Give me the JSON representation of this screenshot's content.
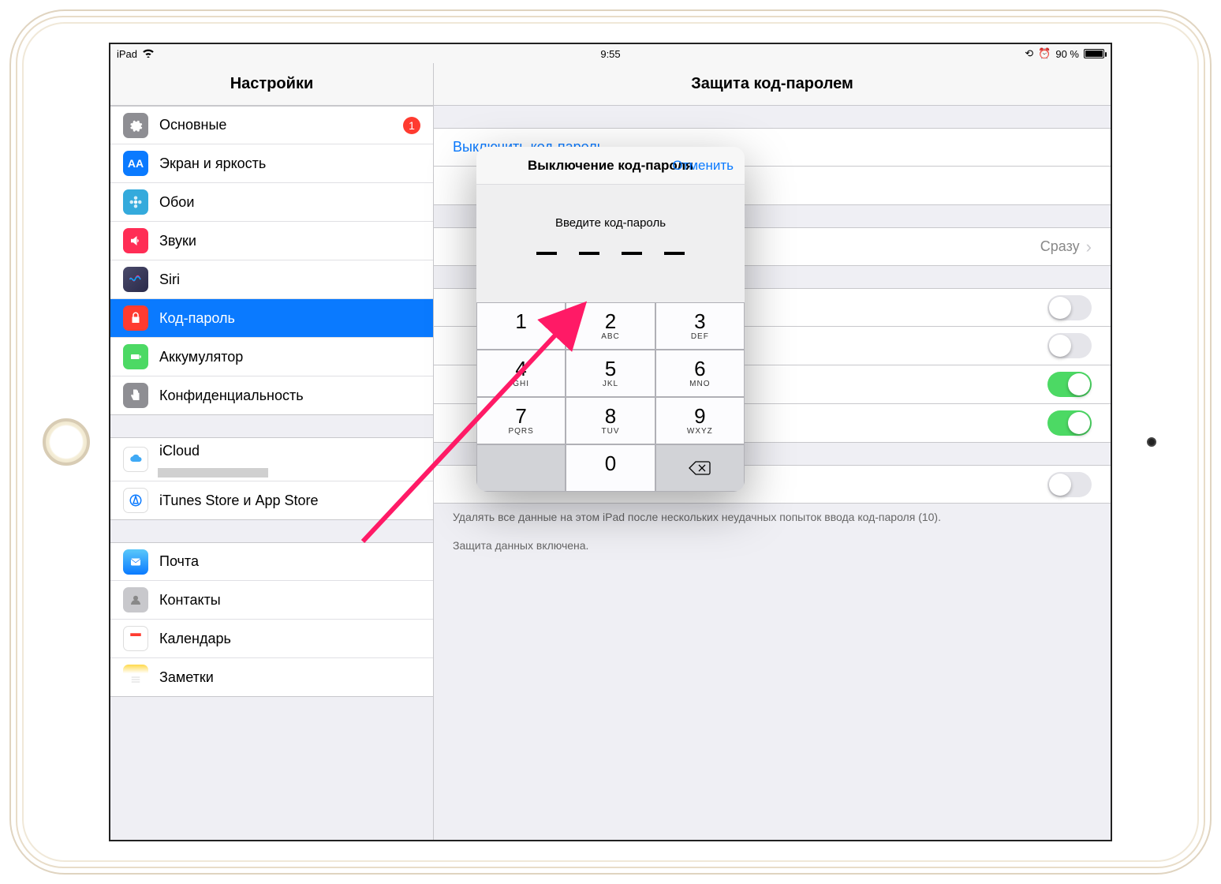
{
  "statusbar": {
    "device": "iPad",
    "time": "9:55",
    "battery_pct": "90 %"
  },
  "sidebar": {
    "title": "Настройки",
    "items": {
      "general": "Основные",
      "general_badge": "1",
      "display": "Экран и яркость",
      "wallpaper": "Обои",
      "sounds": "Звуки",
      "siri": "Siri",
      "passcode": "Код-пароль",
      "battery": "Аккумулятор",
      "privacy": "Конфиденциальность",
      "icloud": "iCloud",
      "itunes": "iTunes Store и App Store",
      "mail": "Почта",
      "contacts": "Контакты",
      "calendar": "Календарь",
      "notes": "Заметки"
    }
  },
  "detail": {
    "title": "Защита код-паролем",
    "turn_off": "Выключить код-пароль",
    "require_value": "Сразу",
    "erase_note": "Удалять все данные на этом iPad после нескольких неудачных попыток ввода код-пароля (10).",
    "protection_note": "Защита данных включена."
  },
  "modal": {
    "title": "Выключение код-пароля",
    "cancel": "Отменить",
    "prompt": "Введите код-пароль",
    "keys": {
      "k1": "1",
      "k2": "2",
      "k2l": "ABC",
      "k3": "3",
      "k3l": "DEF",
      "k4": "4",
      "k4l": "GHI",
      "k5": "5",
      "k5l": "JKL",
      "k6": "6",
      "k6l": "MNO",
      "k7": "7",
      "k7l": "PQRS",
      "k8": "8",
      "k8l": "TUV",
      "k9": "9",
      "k9l": "WXYZ",
      "k0": "0"
    }
  }
}
